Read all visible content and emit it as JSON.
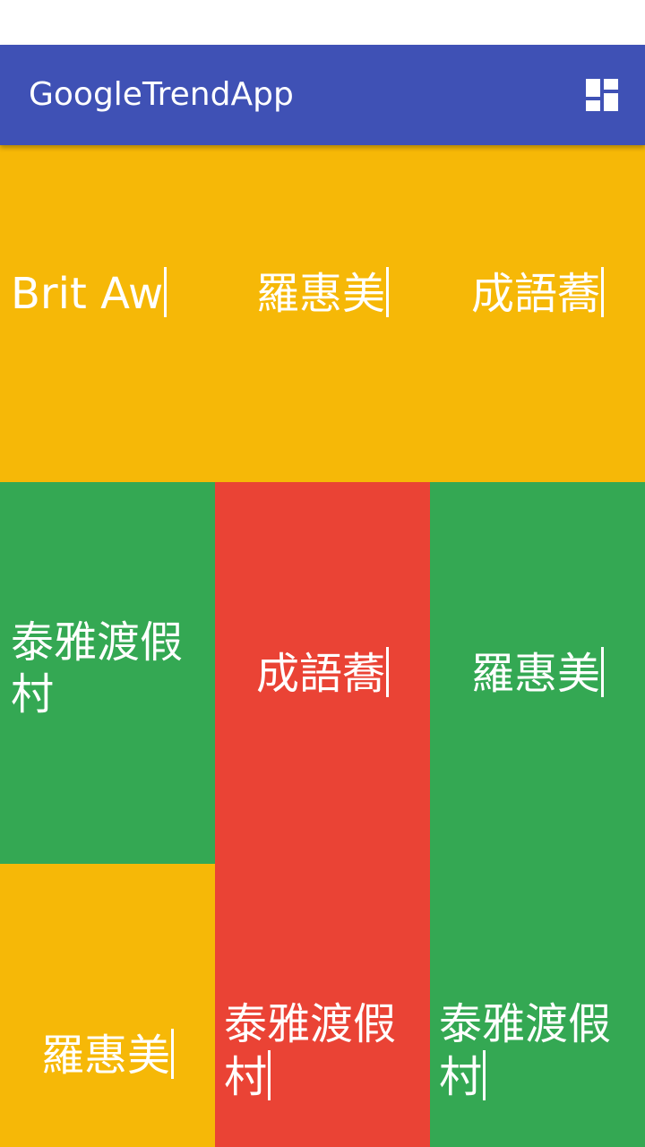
{
  "app": {
    "title": "GoogleTrendApp",
    "menu_icon": "dashboard-grid-icon",
    "colors": {
      "appbar": "#3f51b5",
      "yellow": "#f6b807",
      "green": "#34a853",
      "red": "#ea4335",
      "text": "#ffffff"
    }
  },
  "tiles": [
    {
      "text": "Brit Aw",
      "color": "yellow"
    },
    {
      "text": "羅惠美",
      "color": "yellow"
    },
    {
      "text": "成語蕎",
      "color": "yellow"
    },
    {
      "text": "泰雅渡假村",
      "color": "green"
    },
    {
      "text": "成語蕎",
      "color": "red"
    },
    {
      "text": "羅惠美",
      "color": "green"
    },
    {
      "text": "羅惠美",
      "color": "yellow"
    },
    {
      "text": "泰雅渡假村",
      "color": "red"
    },
    {
      "text": "泰雅渡假村",
      "color": "green"
    }
  ]
}
